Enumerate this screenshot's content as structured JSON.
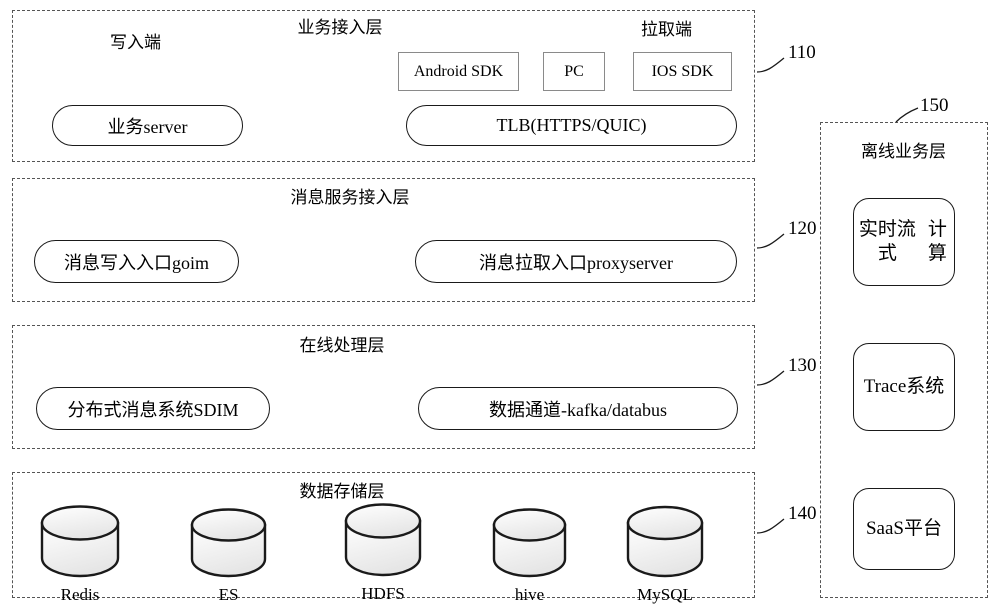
{
  "diagram": {
    "layers": [
      {
        "id": "business-access-layer",
        "title": "业务接入层",
        "ref": "110",
        "sub_labels": [
          {
            "id": "write-side",
            "text": "写入端"
          },
          {
            "id": "pull-side",
            "text": "拉取端"
          }
        ],
        "rect_boxes": [
          {
            "id": "android-sdk",
            "label": "Android SDK"
          },
          {
            "id": "pc",
            "label": "PC"
          },
          {
            "id": "ios-sdk",
            "label": "IOS SDK"
          }
        ],
        "pills": [
          {
            "id": "business-server",
            "label": "业务server"
          },
          {
            "id": "tlb",
            "label": "TLB(HTTPS/QUIC)"
          }
        ]
      },
      {
        "id": "message-service-access-layer",
        "title": "消息服务接入层",
        "ref": "120",
        "pills": [
          {
            "id": "message-write-entry",
            "label": "消息写入入口goim"
          },
          {
            "id": "message-pull-entry",
            "label": "消息拉取入口proxyserver"
          }
        ]
      },
      {
        "id": "online-processing-layer",
        "title": "在线处理层",
        "ref": "130",
        "pills": [
          {
            "id": "sdim",
            "label": "分布式消息系统SDIM"
          },
          {
            "id": "data-channel",
            "label": "数据通道-kafka/databus"
          }
        ]
      },
      {
        "id": "data-storage-layer",
        "title": "数据存储层",
        "ref": "140",
        "stores": [
          {
            "id": "redis",
            "label": "Redis"
          },
          {
            "id": "es",
            "label": "ES"
          },
          {
            "id": "hdfs",
            "label": "HDFS"
          },
          {
            "id": "hive",
            "label": "hive"
          },
          {
            "id": "mysql",
            "label": "MySQL"
          }
        ]
      }
    ],
    "side_column": {
      "id": "offline-business-layer",
      "title": "离线业务层",
      "ref": "150",
      "cards": [
        {
          "id": "realtime-stream-computing",
          "line1": "实时流式",
          "line2": "计算"
        },
        {
          "id": "trace-system",
          "line1": "Trace系统",
          "line2": ""
        },
        {
          "id": "saas-platform",
          "line1": "SaaS平台",
          "line2": ""
        }
      ]
    },
    "colors": {
      "stroke": "#1a1a1a",
      "dashed_stroke": "#555555",
      "rect_stroke": "#8a8a8a",
      "background": "#ffffff",
      "cylinder_fill_top": "#fdfdfd",
      "cylinder_fill_bottom": "#e9e9e9"
    }
  }
}
